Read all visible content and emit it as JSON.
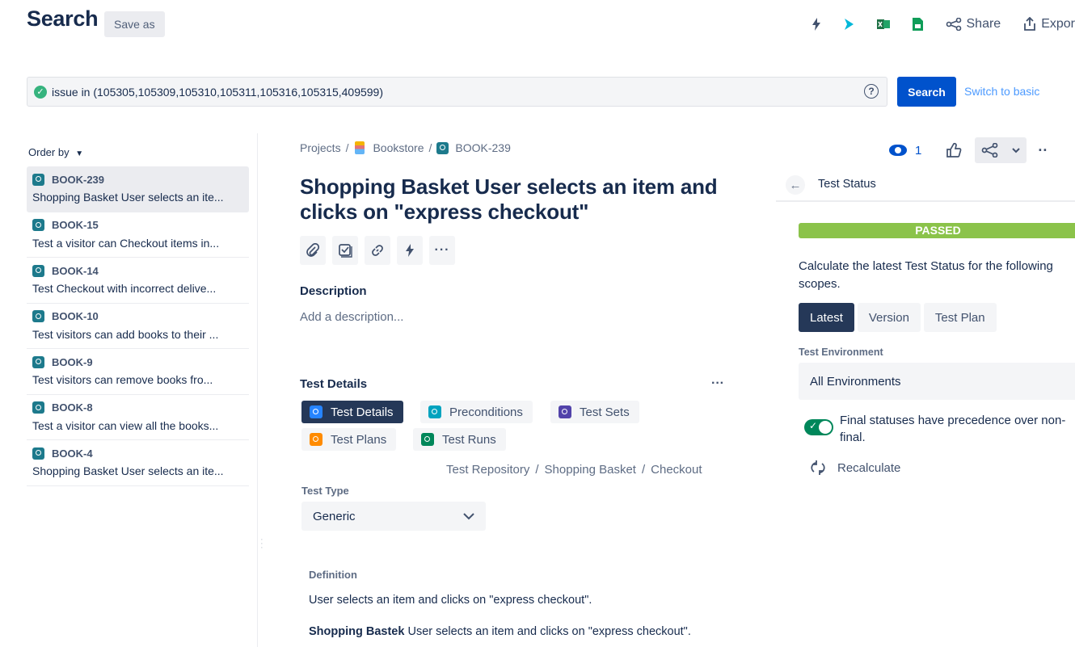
{
  "header": {
    "title": "Search",
    "save_as": "Save as",
    "share": "Share",
    "export": "Expor"
  },
  "search": {
    "query": "issue in (105305,105309,105310,105311,105316,105315,409599)",
    "button": "Search",
    "switch_basic": "Switch to basic"
  },
  "list": {
    "order_by": "Order by",
    "items": [
      {
        "key": "BOOK-239",
        "summary": "Shopping Basket User selects an ite..."
      },
      {
        "key": "BOOK-15",
        "summary": "Test a visitor can Checkout items in..."
      },
      {
        "key": "BOOK-14",
        "summary": "Test Checkout with incorrect delive..."
      },
      {
        "key": "BOOK-10",
        "summary": "Test visitors can add books to their ..."
      },
      {
        "key": "BOOK-9",
        "summary": "Test visitors can remove books fro..."
      },
      {
        "key": "BOOK-8",
        "summary": "Test a visitor can view all the books..."
      },
      {
        "key": "BOOK-4",
        "summary": "Shopping Basket User selects an ite..."
      }
    ]
  },
  "issue": {
    "breadcrumb": {
      "projects": "Projects",
      "project": "Bookstore",
      "key": "BOOK-239"
    },
    "title": "Shopping Basket User selects an item and clicks on \"express checkout\"",
    "description_label": "Description",
    "description_placeholder": "Add a description...",
    "test_details_label": "Test Details",
    "tabs": [
      {
        "label": "Test Details",
        "color": "#2684ff"
      },
      {
        "label": "Preconditions",
        "color": "#00a3bf"
      },
      {
        "label": "Test Sets",
        "color": "#5243aa"
      },
      {
        "label": "Test Plans",
        "color": "#ff8b00"
      },
      {
        "label": "Test Runs",
        "color": "#00875a"
      }
    ],
    "repo_path": [
      "Test Repository",
      "Shopping Basket",
      "Checkout"
    ],
    "test_type_label": "Test Type",
    "test_type_value": "Generic",
    "definition_label": "Definition",
    "definition_text": "User selects an item and clicks on \"express checkout\".",
    "definition_bold": "Shopping Bastek",
    "definition_text2": " User selects an item and clicks on \"express checkout\"."
  },
  "panel": {
    "watchers": "1",
    "title": "Test Status",
    "status": "PASSED",
    "status_color": "#8bc34a",
    "calc_line1": "Calculate the latest Test Status for the following",
    "calc_line2": "scopes.",
    "scopes": [
      "Latest",
      "Version",
      "Test Plan"
    ],
    "env_label": "Test Environment",
    "env_value": "All Environments",
    "toggle_line1": "Final statuses have precedence over non-",
    "toggle_line2": "final.",
    "recalculate": "Recalculate"
  }
}
